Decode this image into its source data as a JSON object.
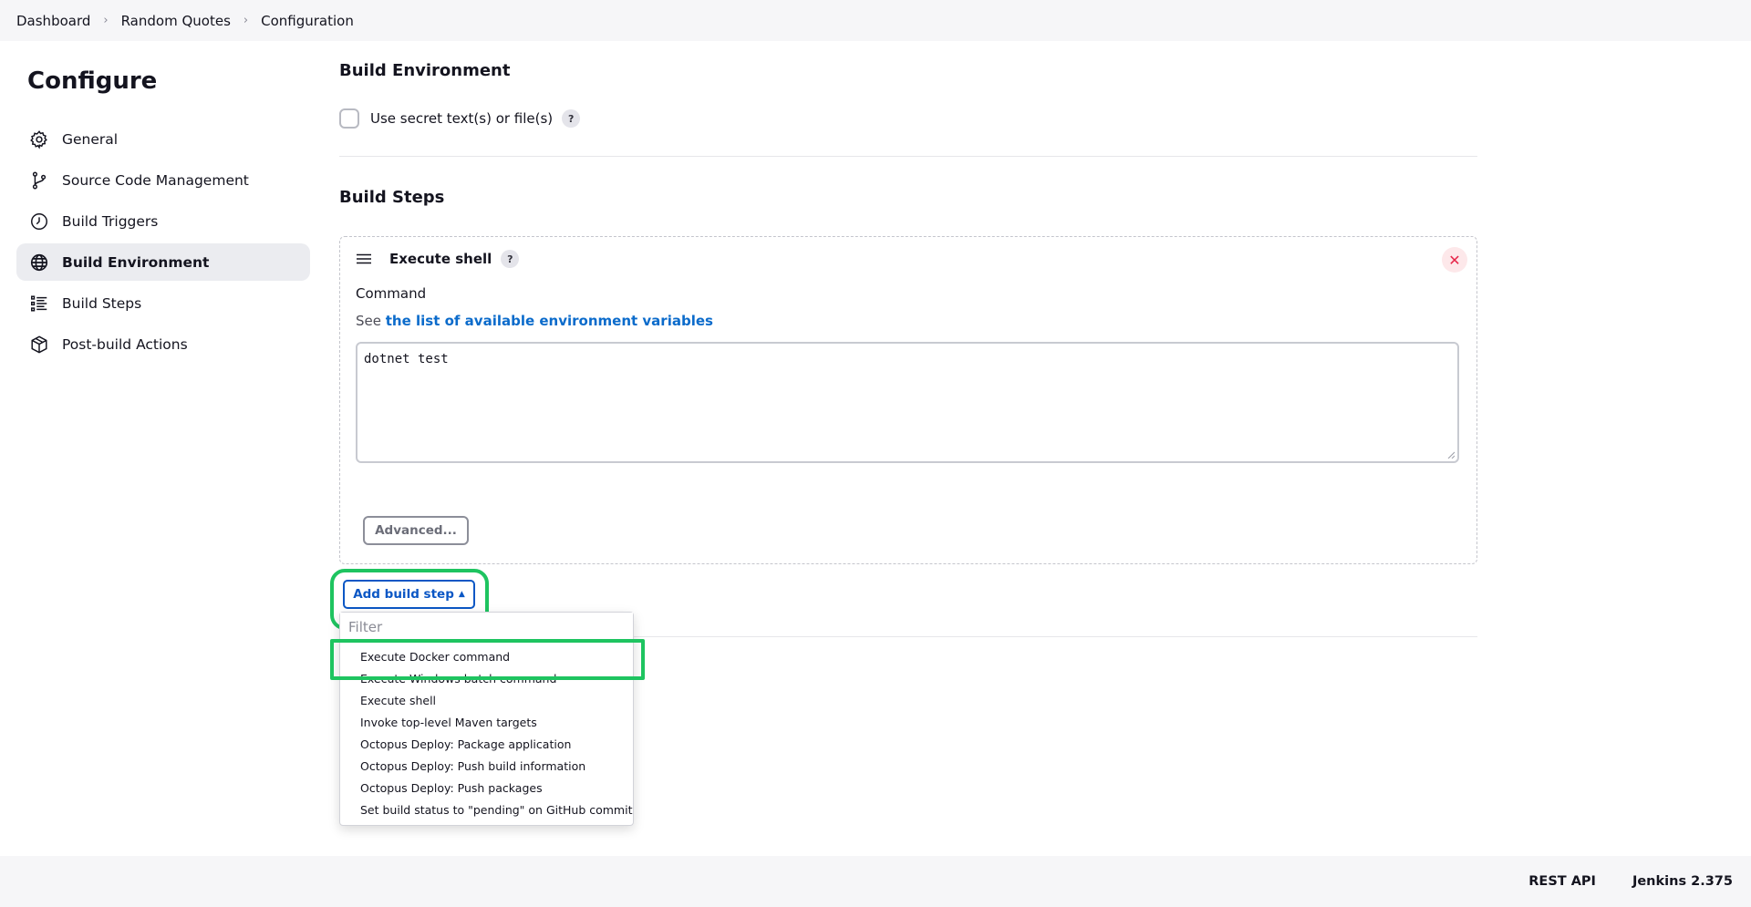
{
  "breadcrumbs": [
    "Dashboard",
    "Random Quotes",
    "Configuration"
  ],
  "sidebar": {
    "title": "Configure",
    "items": [
      {
        "label": "General",
        "icon": "gear-icon"
      },
      {
        "label": "Source Code Management",
        "icon": "branch-icon"
      },
      {
        "label": "Build Triggers",
        "icon": "clock-icon"
      },
      {
        "label": "Build Environment",
        "icon": "globe-icon",
        "active": true
      },
      {
        "label": "Build Steps",
        "icon": "list-icon"
      },
      {
        "label": "Post-build Actions",
        "icon": "package-icon"
      }
    ]
  },
  "build_environment": {
    "title": "Build Environment",
    "secret_checkbox_label": "Use secret text(s) or file(s)",
    "secret_checked": false,
    "help_label": "?"
  },
  "build_steps": {
    "title": "Build Steps",
    "step": {
      "name": "Execute shell",
      "help_label": "?",
      "close_label": "✕",
      "command_label": "Command",
      "see_prefix": "See",
      "env_link": "the list of available environment variables",
      "command_value": "dotnet test",
      "advanced_label": "Advanced..."
    },
    "add_step_label": "Add build step"
  },
  "dropdown": {
    "filter_placeholder": "Filter",
    "items": [
      "Execute Docker command",
      "Execute Windows batch command",
      "Execute shell",
      "Invoke top-level Maven targets",
      "Octopus Deploy: Package application",
      "Octopus Deploy: Push build information",
      "Octopus Deploy: Push packages",
      "Set build status to \"pending\" on GitHub commit"
    ]
  },
  "footer": {
    "rest_api": "REST API",
    "version": "Jenkins 2.375"
  },
  "colors": {
    "highlight_green": "#1ec460",
    "link_blue": "#0b6bcb",
    "button_blue": "#0b57c5",
    "close_red": "#e6264a"
  }
}
